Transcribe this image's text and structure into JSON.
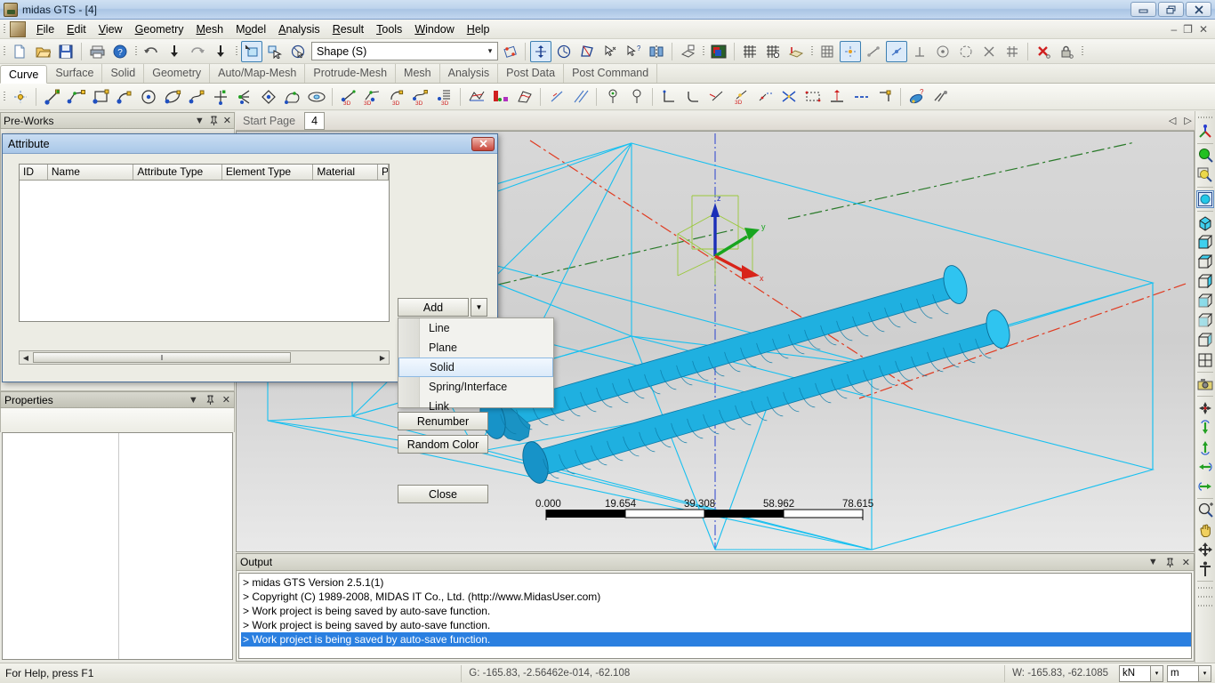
{
  "window": {
    "title": "midas GTS - [4]",
    "buttons": {
      "minimize": "–",
      "restore": "❐",
      "close": "✕"
    },
    "mdi_buttons": {
      "minimize": "–",
      "restore": "❐",
      "close": "✕"
    }
  },
  "menubar": {
    "items": [
      {
        "label": "File"
      },
      {
        "label": "Edit"
      },
      {
        "label": "View"
      },
      {
        "label": "Geometry"
      },
      {
        "label": "Mesh"
      },
      {
        "label": "Model"
      },
      {
        "label": "Analysis"
      },
      {
        "label": "Result"
      },
      {
        "label": "Tools"
      },
      {
        "label": "Window"
      },
      {
        "label": "Help"
      }
    ]
  },
  "toolbar": {
    "shape_selector": "Shape (S)",
    "dropdown_arrow": "▾"
  },
  "tabstrip": {
    "tabs": [
      {
        "label": "Curve",
        "active": true
      },
      {
        "label": "Surface",
        "active": false
      },
      {
        "label": "Solid",
        "active": false
      },
      {
        "label": "Geometry",
        "active": false
      },
      {
        "label": "Auto/Map-Mesh",
        "active": false
      },
      {
        "label": "Protrude-Mesh",
        "active": false
      },
      {
        "label": "Mesh",
        "active": false
      },
      {
        "label": "Analysis",
        "active": false
      },
      {
        "label": "Post Data",
        "active": false
      },
      {
        "label": "Post Command",
        "active": false
      }
    ]
  },
  "left_dock": {
    "preworks_title": "Pre-Works",
    "properties_title": "Properties",
    "header_icons": {
      "menu": "▼",
      "pin": "↥",
      "close": "✕"
    }
  },
  "doc_bar": {
    "start_page": "Start Page",
    "active_doc": "4",
    "nav": {
      "prev": "◁",
      "next": "▷",
      "close": "✕"
    }
  },
  "dialog": {
    "title": "Attribute",
    "close_label": "✕",
    "columns": [
      "ID",
      "Name",
      "Attribute Type",
      "Element Type",
      "Material",
      "P"
    ],
    "rows": [],
    "buttons": {
      "add": "Add",
      "add_arrow": "▼",
      "renumber": "Renumber",
      "random_color": "Random Color",
      "close": "Close"
    },
    "add_menu": {
      "items": [
        {
          "label": "Line",
          "selected": false
        },
        {
          "label": "Plane",
          "selected": false
        },
        {
          "label": "Solid",
          "selected": true
        },
        {
          "label": "Spring/Interface",
          "selected": false
        },
        {
          "label": "Link",
          "selected": false
        }
      ]
    },
    "scrollbar": {
      "left_arrow": "◀",
      "right_arrow": "▶",
      "grip": "‖"
    }
  },
  "viewport": {
    "axis_labels": {
      "x": "x",
      "y": "y",
      "z": "z"
    },
    "scale_ticks": [
      "0.000",
      "19.654",
      "39.308",
      "58.962",
      "78.615"
    ],
    "colors": {
      "model_cyan": "#1fb6e8",
      "wireframe": "#18c0f0",
      "axis_x": "#e03a20",
      "axis_y": "#1f8a2f",
      "axis_z": "#2a3fd0",
      "background_top": "#d8d8d8",
      "background_bottom": "#e9e9e9"
    }
  },
  "output": {
    "title": "Output",
    "lines": [
      {
        "text": "> midas GTS Version 2.5.1(1)",
        "selected": false
      },
      {
        "text": "> Copyright (C) 1989-2008, MIDAS IT Co., Ltd. (http://www.MidasUser.com)",
        "selected": false
      },
      {
        "text": "> Work project is being saved by auto-save function.",
        "selected": false
      },
      {
        "text": "> Work project is being saved by auto-save function.",
        "selected": false
      },
      {
        "text": "> Work project is being saved by auto-save function.",
        "selected": true
      }
    ],
    "header_icons": {
      "menu": "▼",
      "pin": "↥",
      "close": "✕"
    }
  },
  "statusbar": {
    "help_text": "For Help, press F1",
    "global_coords": "G: -165.83, -2.56462e-014, -62.108",
    "work_coords": "W: -165.83, -62.1085",
    "force_unit": "kN",
    "length_unit": "m",
    "arrow": "▾"
  }
}
